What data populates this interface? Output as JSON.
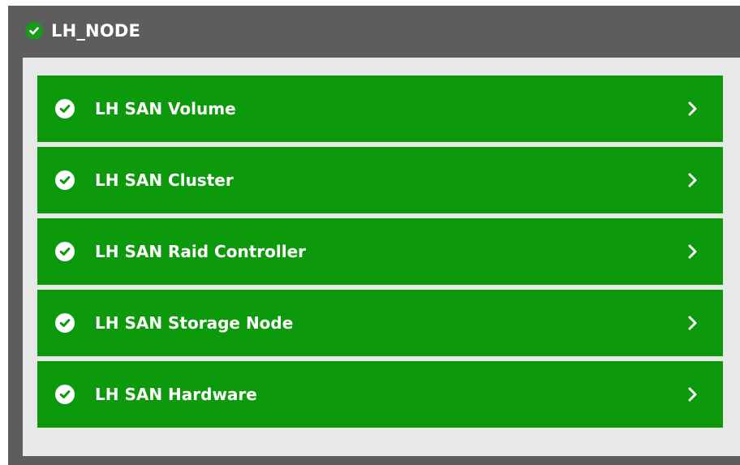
{
  "panel": {
    "title": "LH_NODE",
    "status": "ok",
    "colors": {
      "header_bg": "#5d5d5d",
      "body_bg": "#e8e8e8",
      "item_bg": "#0c9a0c",
      "ok_green": "#1a9a1a",
      "text": "#ffffff"
    }
  },
  "items": [
    {
      "label": "LH SAN Volume",
      "status": "ok",
      "icon": "check-circle-icon",
      "chevron": "chevron-right-icon"
    },
    {
      "label": "LH SAN Cluster",
      "status": "ok",
      "icon": "check-circle-icon",
      "chevron": "chevron-right-icon"
    },
    {
      "label": "LH SAN Raid Controller",
      "status": "ok",
      "icon": "check-circle-icon",
      "chevron": "chevron-right-icon"
    },
    {
      "label": "LH SAN Storage Node",
      "status": "ok",
      "icon": "check-circle-icon",
      "chevron": "chevron-right-icon"
    },
    {
      "label": "LH SAN Hardware",
      "status": "ok",
      "icon": "check-circle-icon",
      "chevron": "chevron-right-icon"
    }
  ]
}
